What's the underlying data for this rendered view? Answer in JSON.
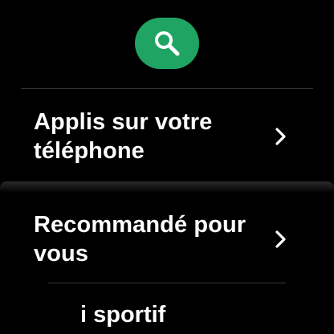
{
  "search": {
    "icon": "search-icon",
    "color": "#1fa463"
  },
  "items": [
    {
      "label": "Applis sur votre téléphone",
      "icon": "chevron-right-icon"
    },
    {
      "label": "Recommandé pour vous",
      "icon": "chevron-right-icon"
    },
    {
      "label": "i sportif"
    }
  ]
}
